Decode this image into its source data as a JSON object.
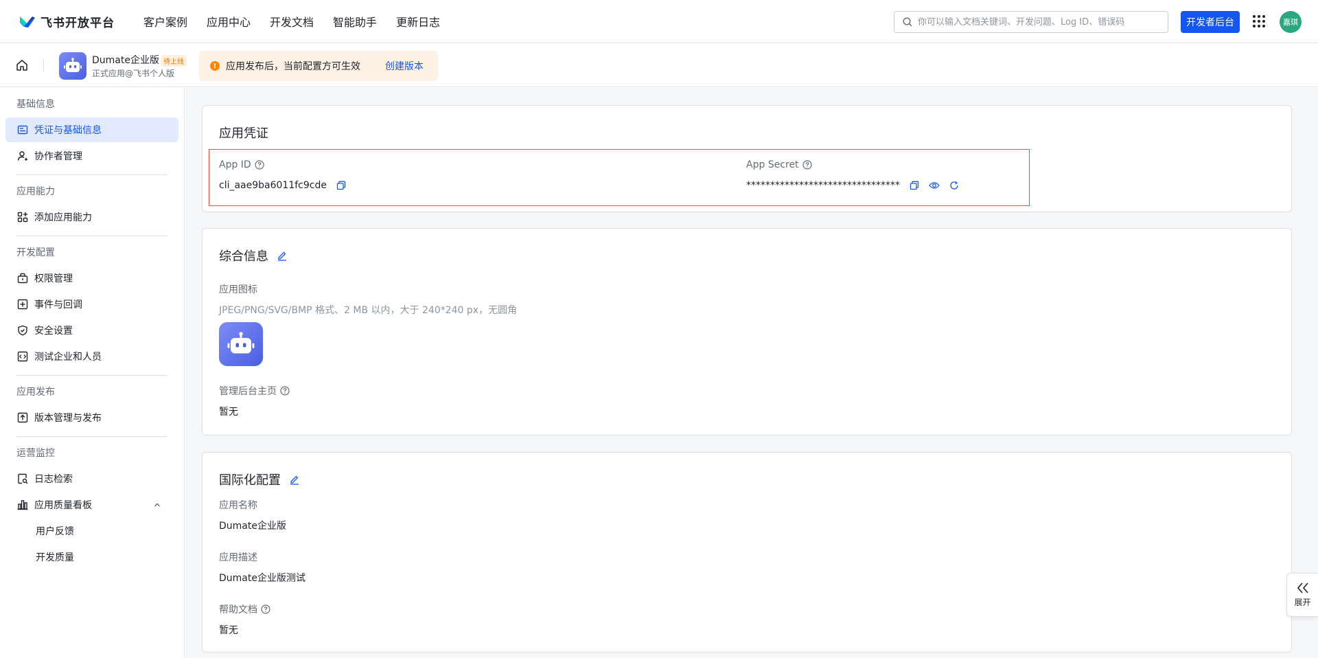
{
  "brand": {
    "name": "飞书开放平台"
  },
  "nav": {
    "items": [
      "客户案例",
      "应用中心",
      "开发文档",
      "智能助手",
      "更新日志"
    ]
  },
  "search": {
    "placeholder": "你可以输入文档关键词、开发问题、Log ID、错误码",
    "icon": "search-icon"
  },
  "header": {
    "dev_console_label": "开发者后台",
    "avatar_text": "嘉琪",
    "avatar_color": "#2aa77f",
    "accent": "#1456f0"
  },
  "app": {
    "name": "Dumate企业版",
    "badge": "待上线",
    "subtitle": "正式应用@飞书个人版"
  },
  "notice": {
    "text": "应用发布后，当前配置方可生效",
    "link": "创建版本",
    "icon": "warning-icon"
  },
  "sidebar": {
    "groups": [
      {
        "title": "基础信息",
        "items": [
          {
            "label": "凭证与基础信息",
            "active": true,
            "icon": "credential-icon"
          },
          {
            "label": "协作者管理",
            "icon": "user-add-icon"
          }
        ]
      },
      {
        "title": "应用能力",
        "items": [
          {
            "label": "添加应用能力",
            "icon": "apps-add-icon"
          }
        ]
      },
      {
        "title": "开发配置",
        "items": [
          {
            "label": "权限管理",
            "icon": "lock-bag-icon"
          },
          {
            "label": "事件与回调",
            "icon": "event-icon"
          },
          {
            "label": "安全设置",
            "icon": "shield-icon"
          },
          {
            "label": "测试企业和人员",
            "icon": "code-box-icon"
          }
        ]
      },
      {
        "title": "应用发布",
        "items": [
          {
            "label": "版本管理与发布",
            "icon": "upload-icon"
          }
        ]
      },
      {
        "title": "运营监控",
        "items": [
          {
            "label": "日志检索",
            "icon": "log-search-icon"
          },
          {
            "label": "应用质量看板",
            "icon": "bar-chart-icon",
            "expanded": true
          },
          {
            "label": "用户反馈",
            "sub": true
          },
          {
            "label": "开发质量",
            "sub": true
          }
        ]
      }
    ]
  },
  "credentials": {
    "title": "应用凭证",
    "app_id_label": "App ID",
    "app_id_value": "cli_aae9ba6011fc9cde",
    "app_secret_label": "App Secret",
    "app_secret_value": "********************************"
  },
  "general": {
    "title": "综合信息",
    "icon_label": "应用图标",
    "icon_hint": "JPEG/PNG/SVG/BMP 格式、2 MB 以内，大于 240*240 px，无圆角",
    "admin_home_label": "管理后台主页",
    "admin_home_value": "暂无"
  },
  "i18n": {
    "title": "国际化配置",
    "name_label": "应用名称",
    "name_value": "Dumate企业版",
    "desc_label": "应用描述",
    "desc_value": "Dumate企业版测试",
    "help_label": "帮助文档",
    "help_value": "暂无"
  },
  "expand_panel": {
    "label": "展开"
  }
}
